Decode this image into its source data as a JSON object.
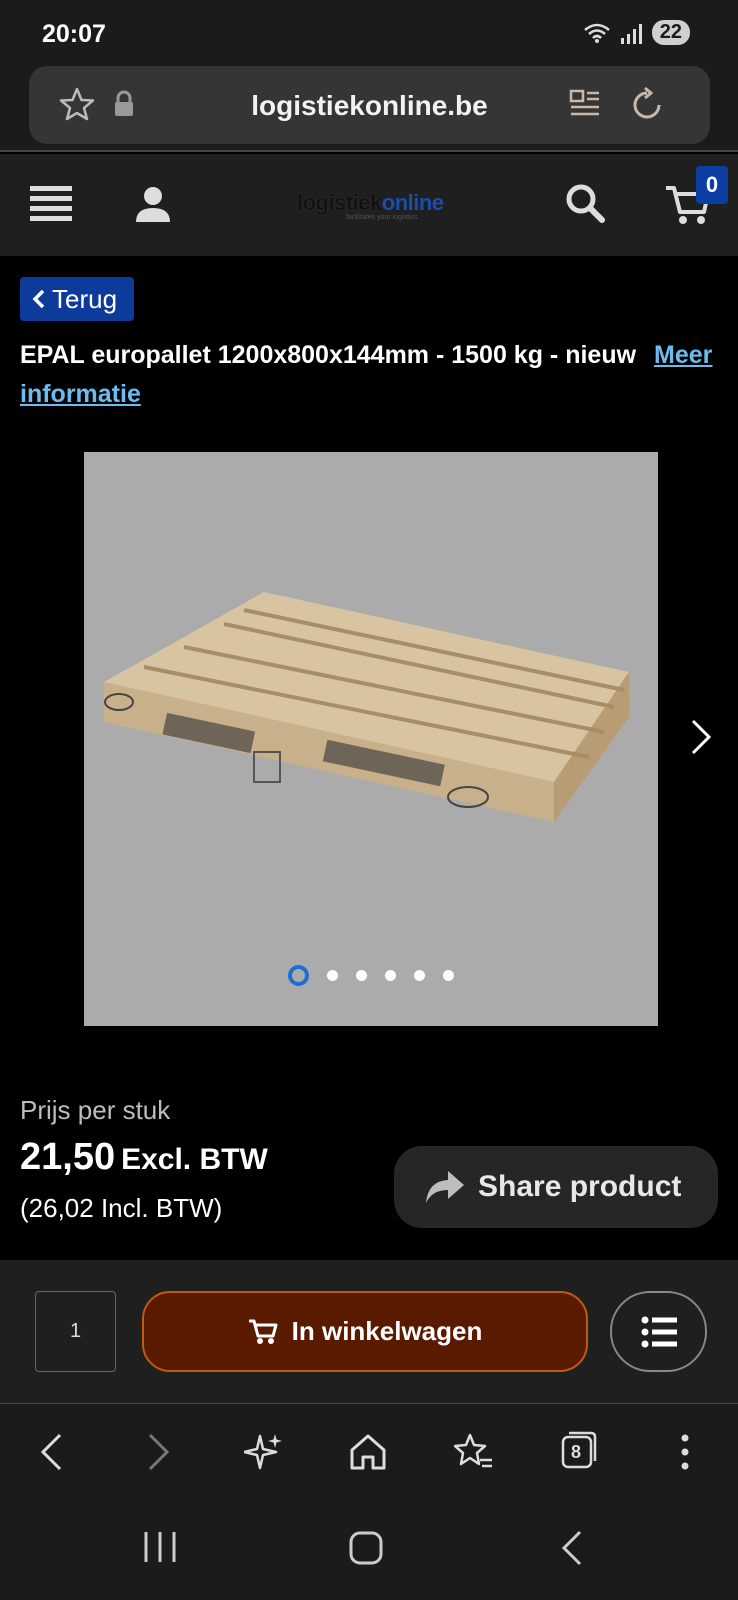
{
  "status_bar": {
    "time": "20:07",
    "battery": "22"
  },
  "browser": {
    "url": "logistiekonline.be"
  },
  "site_header": {
    "logo_part1": "logistiek",
    "logo_part2": "online",
    "logo_tagline": "facilitates your logistics",
    "cart_count": "0"
  },
  "product": {
    "back_label": "Terug",
    "title": "EPAL europallet 1200x800x144mm - 1500 kg - nieuw",
    "more_info": "Meer informatie",
    "image_count": 6,
    "active_image": 1,
    "price_label": "Prijs per stuk",
    "price": "21,50",
    "price_excl": "Excl. BTW",
    "price_incl": "(26,02 Incl. BTW)",
    "share_label": "Share product"
  },
  "buy_bar": {
    "quantity": "1",
    "add_to_cart_label": "In winkelwagen"
  },
  "browser_nav": {
    "tab_count": "8"
  },
  "colors": {
    "accent_blue": "#0d3b9c",
    "cart_button": "#5a1a00",
    "link": "#6cbcf0"
  }
}
